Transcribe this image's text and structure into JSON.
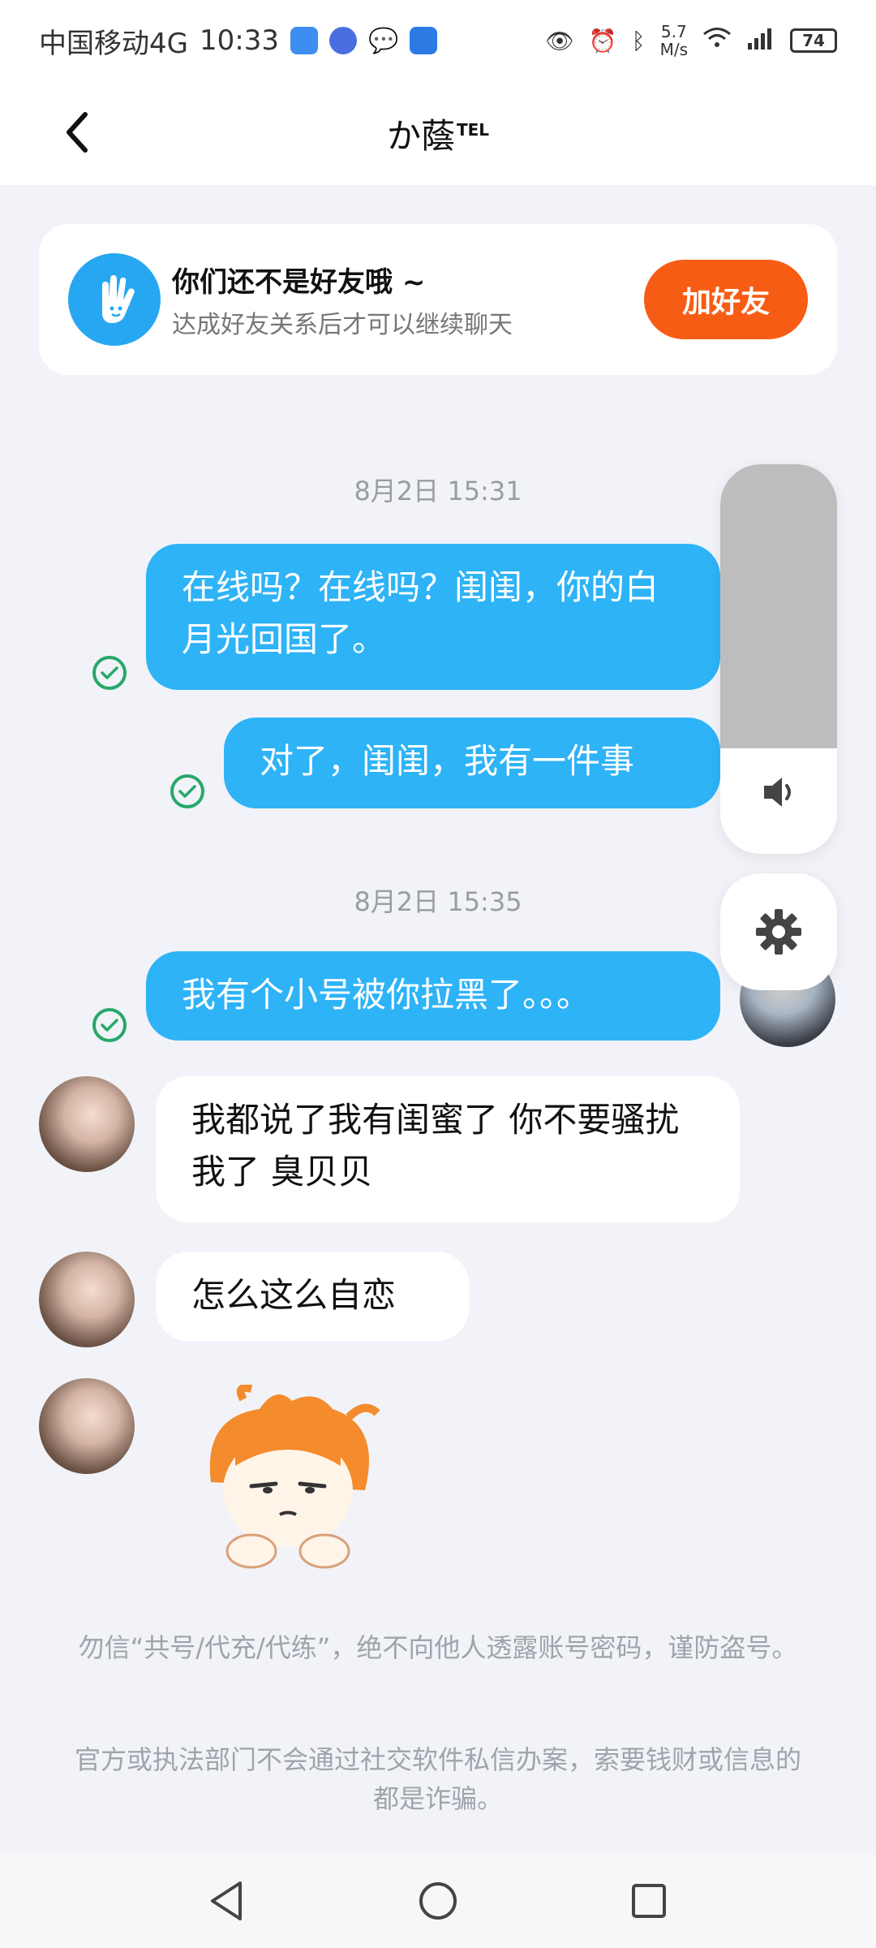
{
  "status_bar": {
    "carrier": "中国移动4G",
    "time": "10:33",
    "speed_value": "5.7",
    "speed_unit": "M/s",
    "battery": "74"
  },
  "header": {
    "title": "か蔭",
    "title_suffix": "TEL"
  },
  "friend_card": {
    "title": "你们还不是好友哦 ~",
    "subtitle": "达成好友关系后才可以继续聊天",
    "add_button": "加好友"
  },
  "chat": {
    "time_1": "8月2日 15:31",
    "msg_1": "在线吗？在线吗？闺闺，你的白月光回国了。",
    "msg_2": "对了，闺闺，我有一件事",
    "time_2": "8月2日 15:35",
    "msg_3": "我有个小号被你拉黑了。。。",
    "reply_1": "我都说了我有闺蜜了 你不要骚扰我了 臭贝贝",
    "reply_2": "怎么这么自恋"
  },
  "notices": {
    "notice_1": "勿信“共号/代充/代练”，绝不向他人透露账号密码，谨防盗号。",
    "notice_2": "官方或执法部门不会通过社交软件私信办案，索要钱财或信息的都是诈骗。"
  },
  "volume_level": 0.73,
  "colors": {
    "accent": "#2eb3f7",
    "add_button": "#f75c15",
    "read_check": "#27a86a"
  }
}
